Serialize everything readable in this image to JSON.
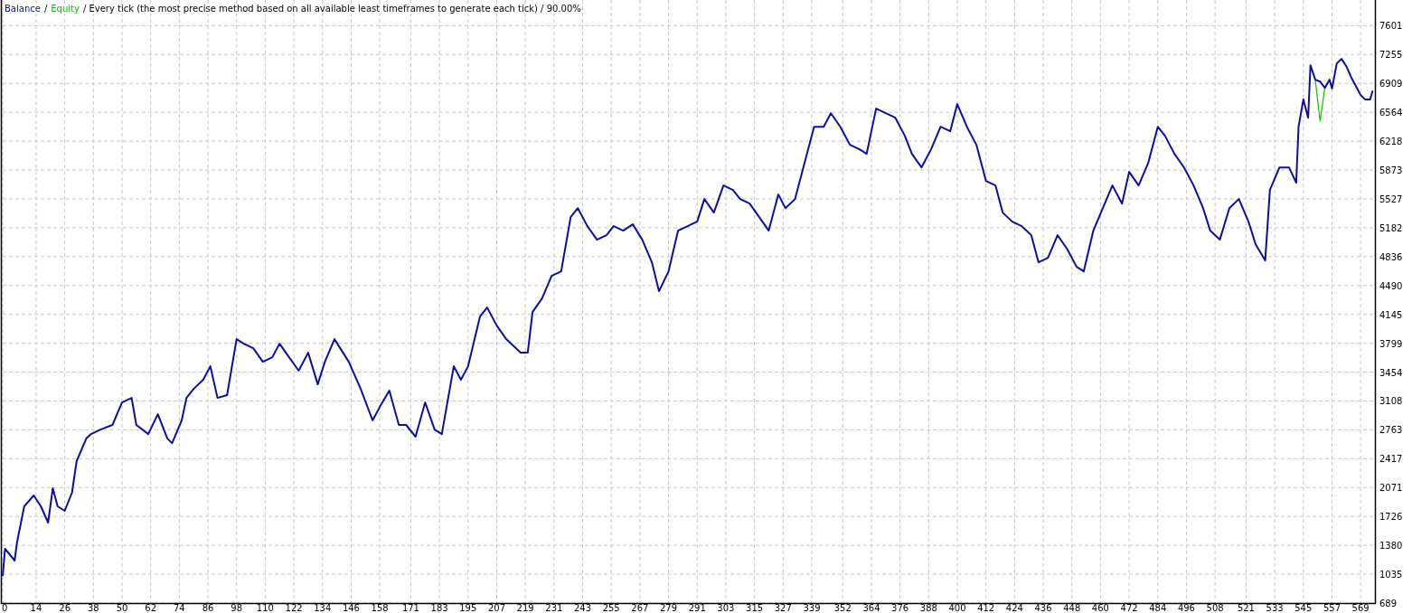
{
  "legend_separator": "/",
  "chart_data": {
    "type": "line",
    "title": "/ Every tick (the most precise method based on all available least timeframes to generate each tick) / 90.00%",
    "x": [
      0,
      1,
      5,
      6,
      9,
      13,
      16,
      19,
      21,
      23,
      26,
      29,
      31,
      35,
      37,
      41,
      46,
      50,
      54,
      56,
      61,
      65,
      69,
      71,
      75,
      77,
      80,
      84,
      87,
      90,
      94,
      98,
      101,
      105,
      109,
      113,
      116,
      120,
      124,
      128,
      132,
      135,
      139,
      145,
      150,
      155,
      158,
      162,
      166,
      169,
      173,
      177,
      181,
      184,
      186,
      189,
      192,
      195,
      200,
      203,
      207,
      211,
      215,
      217,
      220,
      222,
      226,
      230,
      234,
      238,
      241,
      245,
      249,
      253,
      256,
      260,
      264,
      268,
      272,
      275,
      279,
      283,
      287,
      291,
      294,
      298,
      302,
      306,
      309,
      313,
      317,
      321,
      325,
      328,
      332,
      336,
      340,
      344,
      347,
      351,
      355,
      359,
      362,
      366,
      370,
      374,
      378,
      381,
      385,
      389,
      393,
      397,
      400,
      404,
      408,
      412,
      416,
      419,
      423,
      427,
      431,
      434,
      438,
      442,
      446,
      450,
      453,
      457,
      461,
      465,
      469,
      472,
      476,
      480,
      484,
      487,
      491,
      495,
      499,
      503,
      506,
      510,
      514,
      518,
      522,
      525,
      529,
      531,
      535,
      539,
      542,
      543,
      545,
      547,
      548,
      550,
      552,
      554,
      556,
      557,
      559,
      561,
      563,
      565,
      567,
      569,
      571,
      573,
      574
    ],
    "series": [
      {
        "name": "Balance",
        "color": "#0a0fa0",
        "values": [
          1014,
          1338,
          1198,
          1414,
          1847,
          1977,
          1847,
          1652,
          2063,
          1847,
          1793,
          2009,
          2388,
          2658,
          2712,
          2766,
          2821,
          3091,
          3145,
          2821,
          2712,
          2950,
          2658,
          2604,
          2875,
          3145,
          3253,
          3362,
          3524,
          3145,
          3178,
          3848,
          3794,
          3740,
          3578,
          3632,
          3794,
          3632,
          3470,
          3686,
          3307,
          3578,
          3848,
          3578,
          3253,
          2875,
          3037,
          3232,
          2821,
          2821,
          2680,
          3091,
          2766,
          2712,
          3037,
          3524,
          3362,
          3524,
          4119,
          4227,
          4011,
          3848,
          3740,
          3686,
          3686,
          4173,
          4335,
          4606,
          4660,
          5309,
          5417,
          5201,
          5039,
          5093,
          5201,
          5147,
          5223,
          5039,
          4768,
          4422,
          4660,
          5147,
          5201,
          5255,
          5526,
          5363,
          5688,
          5634,
          5526,
          5471,
          5309,
          5147,
          5580,
          5417,
          5526,
          5958,
          6391,
          6391,
          6553,
          6391,
          6175,
          6121,
          6067,
          6608,
          6553,
          6499,
          6283,
          6067,
          5904,
          6121,
          6391,
          6337,
          6662,
          6391,
          6175,
          5742,
          5688,
          5363,
          5255,
          5201,
          5093,
          4768,
          4822,
          5093,
          4930,
          4714,
          4660,
          5147,
          5417,
          5688,
          5471,
          5850,
          5688,
          5958,
          6391,
          6283,
          6067,
          5904,
          5688,
          5417,
          5147,
          5039,
          5417,
          5526,
          5255,
          4984,
          4790,
          5634,
          5904,
          5904,
          5720,
          6391,
          6716,
          6499,
          7127,
          6954,
          6932,
          6856,
          6954,
          6846,
          7149,
          7203,
          7116,
          6986,
          6878,
          6770,
          6716,
          6716,
          6824
        ]
      },
      {
        "name": "Equity",
        "color": "#00c800",
        "values": [
          null,
          null,
          null,
          null,
          null,
          null,
          null,
          null,
          null,
          null,
          null,
          null,
          null,
          null,
          null,
          null,
          null,
          null,
          null,
          null,
          null,
          null,
          null,
          null,
          null,
          null,
          null,
          null,
          null,
          null,
          null,
          null,
          null,
          null,
          null,
          null,
          null,
          null,
          null,
          null,
          null,
          null,
          null,
          null,
          null,
          null,
          null,
          null,
          null,
          null,
          null,
          null,
          null,
          null,
          null,
          null,
          null,
          null,
          null,
          null,
          null,
          null,
          null,
          null,
          null,
          null,
          null,
          null,
          null,
          null,
          null,
          null,
          null,
          null,
          null,
          null,
          null,
          null,
          null,
          null,
          null,
          null,
          null,
          null,
          null,
          null,
          null,
          null,
          null,
          null,
          null,
          null,
          null,
          null,
          null,
          null,
          null,
          null,
          null,
          null,
          null,
          null,
          null,
          null,
          null,
          null,
          null,
          null,
          null,
          null,
          null,
          null,
          null,
          null,
          null,
          null,
          null,
          null,
          null,
          null,
          null,
          null,
          null,
          null,
          null,
          null,
          null,
          null,
          null,
          null,
          null,
          null,
          null,
          null,
          null,
          null,
          null,
          null,
          null,
          null,
          null,
          null,
          null,
          null,
          null,
          null,
          null,
          null,
          null,
          null,
          null,
          null,
          null,
          null,
          null,
          6954,
          6460,
          6856,
          null,
          null,
          null,
          null,
          null,
          null,
          null,
          null,
          null,
          null,
          null
        ]
      }
    ],
    "xlim": [
      0,
      575
    ],
    "ylim": [
      689,
      7908
    ],
    "grid": true,
    "xticks": [
      0,
      14,
      26,
      38,
      50,
      62,
      74,
      86,
      98,
      110,
      122,
      134,
      146,
      158,
      171,
      183,
      195,
      207,
      219,
      231,
      243,
      255,
      267,
      279,
      291,
      303,
      315,
      327,
      339,
      352,
      364,
      376,
      388,
      400,
      412,
      424,
      436,
      448,
      460,
      472,
      484,
      496,
      508,
      521,
      533,
      545,
      557,
      569
    ],
    "yticks": [
      689,
      1035,
      1380,
      1726,
      2071,
      2417,
      2763,
      3108,
      3454,
      3799,
      4145,
      4490,
      4836,
      5182,
      5527,
      5873,
      6218,
      6564,
      6909,
      7255,
      7601
    ]
  }
}
